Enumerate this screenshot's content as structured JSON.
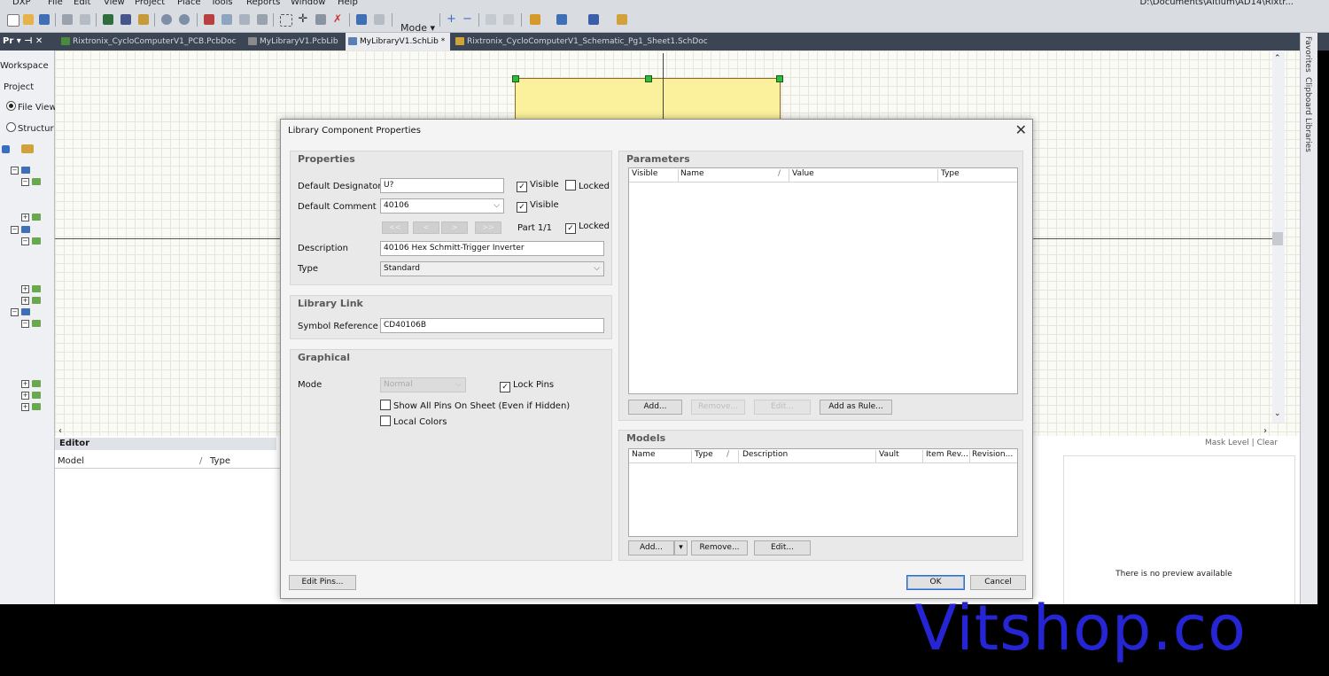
{
  "menubar": {
    "items": [
      "DXP",
      "File",
      "Edit",
      "View",
      "Project",
      "Place",
      "Tools",
      "Reports",
      "Window",
      "Help"
    ],
    "path": "D:\\Documents\\Altium\\AD14\\Rixtr..."
  },
  "toolbar": {
    "mode_label": "Mode"
  },
  "panel": {
    "header": "Pr",
    "workspace": "Workspace",
    "project": "Project",
    "file_view": "File View",
    "structure": "Structur"
  },
  "tabs": [
    {
      "label": "Rixtronix_CycloComputerV1_PCB.PcbDoc",
      "active": false
    },
    {
      "label": "MyLibraryV1.PcbLib",
      "active": false
    },
    {
      "label": "MyLibraryV1.SchLib *",
      "active": true
    },
    {
      "label": "Rixtronix_CycloComputerV1_Schematic_Pg1_Sheet1.SchDoc",
      "active": false
    }
  ],
  "right_dock": [
    "Favorites",
    "Clipboard",
    "Libraries"
  ],
  "bottom": {
    "editor_title": "Editor",
    "col_model": "Model",
    "col_type": "Type",
    "mask_level": "Mask Level",
    "clear": "Clear",
    "preview_text": "There is no preview available"
  },
  "dialog": {
    "title": "Library Component Properties",
    "properties": {
      "title": "Properties",
      "default_designator_label": "Default Designator",
      "default_designator_value": "U?",
      "visible_label": "Visible",
      "locked_label": "Locked",
      "default_comment_label": "Default Comment",
      "default_comment_value": "40106",
      "part_label": "Part 1/1",
      "description_label": "Description",
      "description_value": "40106 Hex Schmitt-Trigger Inverter",
      "type_label": "Type",
      "type_value": "Standard"
    },
    "library_link": {
      "title": "Library Link",
      "symbol_reference_label": "Symbol Reference",
      "symbol_reference_value": "CD40106B"
    },
    "graphical": {
      "title": "Graphical",
      "mode_label": "Mode",
      "mode_value": "Normal",
      "lock_pins": "Lock Pins",
      "show_all_pins": "Show All Pins On Sheet (Even if Hidden)",
      "local_colors": "Local Colors"
    },
    "parameters": {
      "title": "Parameters",
      "columns": [
        "Visible",
        "Name",
        "/",
        "Value",
        "Type"
      ],
      "buttons": [
        "Add...",
        "Remove...",
        "Edit...",
        "Add as Rule..."
      ]
    },
    "models": {
      "title": "Models",
      "columns": [
        "Name",
        "Type",
        "/",
        "Description",
        "Vault",
        "Item Rev...",
        "Revision..."
      ],
      "buttons": [
        "Add...",
        "Remove...",
        "Edit..."
      ]
    },
    "edit_pins": "Edit Pins...",
    "ok": "OK",
    "cancel": "Cancel"
  },
  "watermark": "Vitshop.co"
}
